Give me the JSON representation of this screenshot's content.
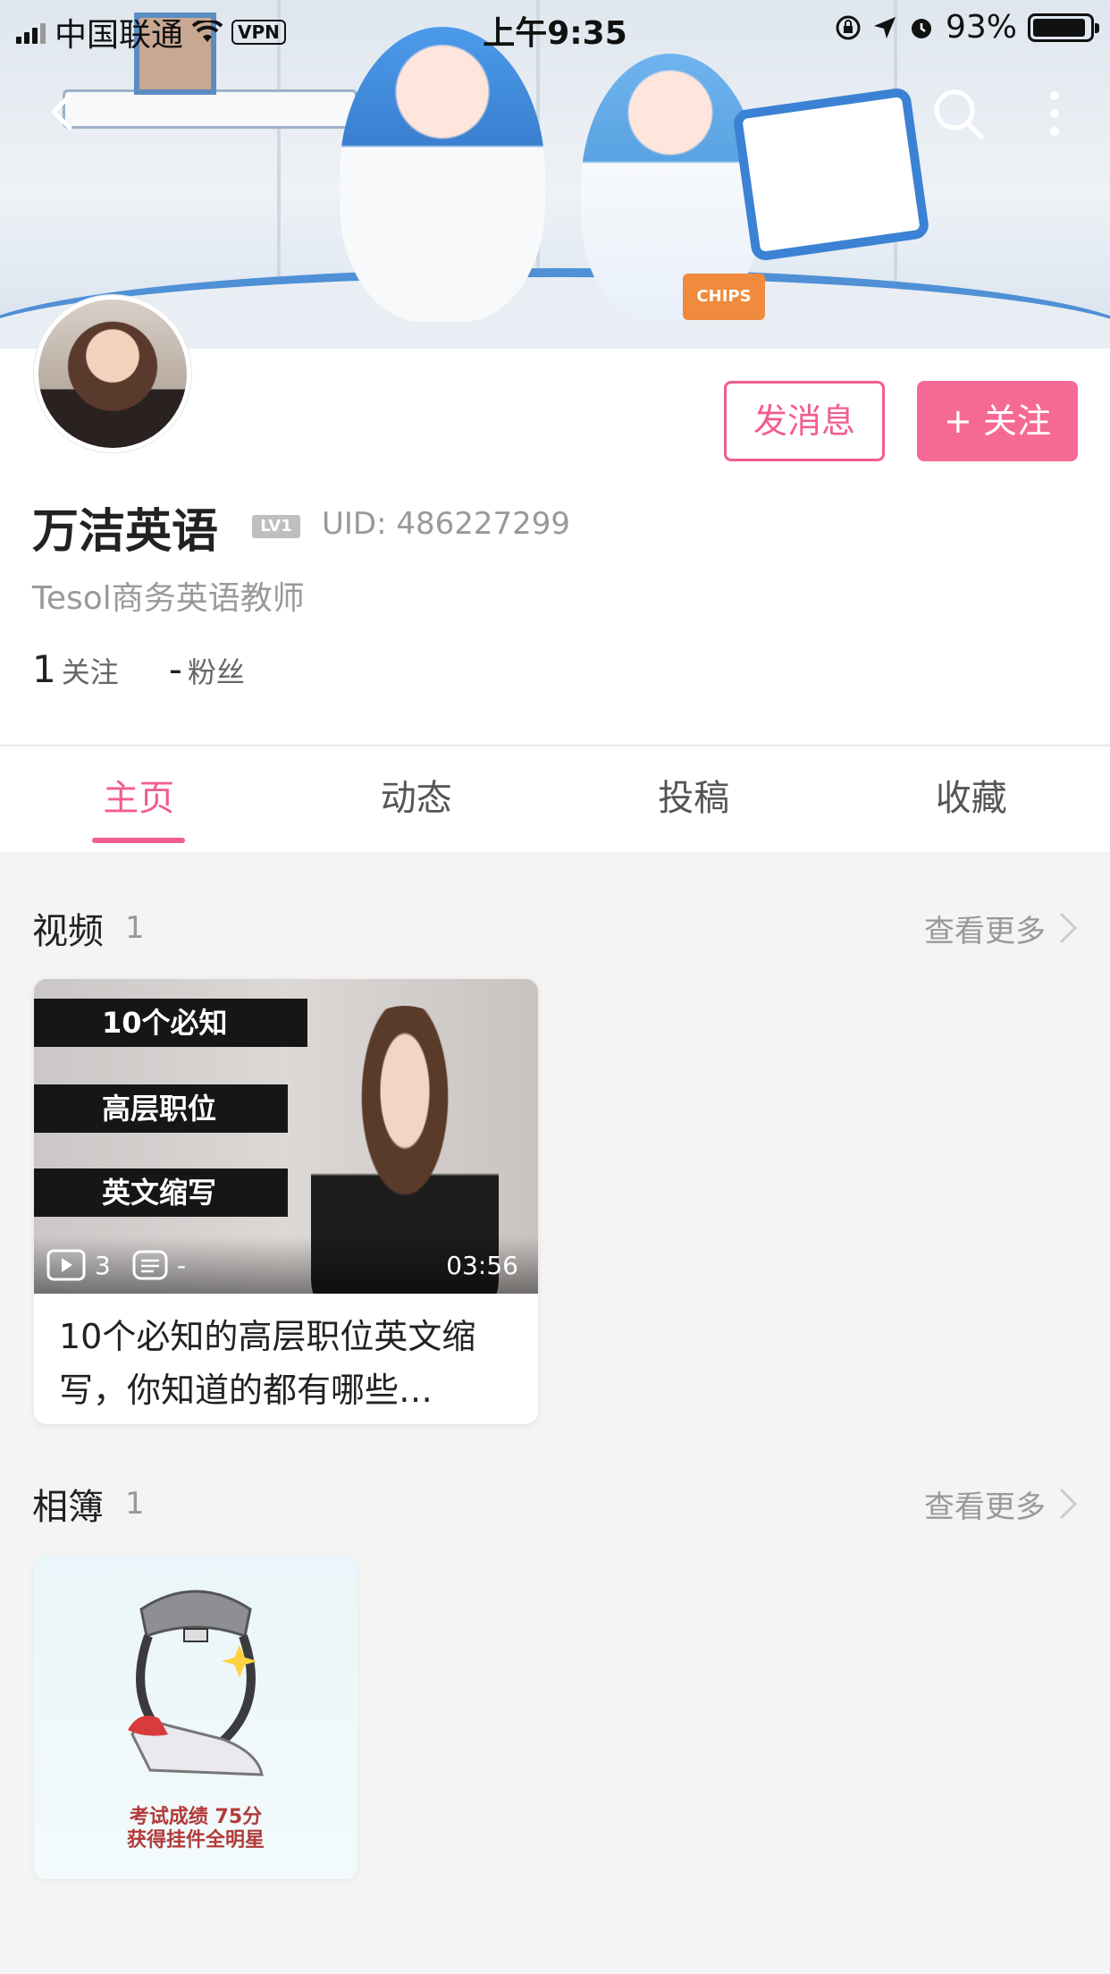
{
  "status_bar": {
    "carrier": "中国联通",
    "vpn": "VPN",
    "time": "上午9:35",
    "battery": "93%",
    "battery_level": 0.93
  },
  "nav": {
    "back_icon": "chevron-left-icon",
    "search_icon": "search-icon",
    "more_icon": "more-vertical-icon"
  },
  "banner": {
    "chips_text": "CHIPS"
  },
  "profile": {
    "name": "万洁英语",
    "level": "LV1",
    "uid_label": "UID:",
    "uid": "486227299",
    "bio": "Tesol商务英语教师",
    "following_count": "1",
    "following_label": "关注",
    "fans_count": "-",
    "fans_label": "粉丝",
    "message_button": "发消息",
    "follow_button": "+ 关注"
  },
  "tabs": [
    {
      "label": "主页",
      "active": true
    },
    {
      "label": "动态",
      "active": false
    },
    {
      "label": "投稿",
      "active": false
    },
    {
      "label": "收藏",
      "active": false
    }
  ],
  "videos_section": {
    "title": "视频",
    "count": "1",
    "more": "查看更多",
    "video": {
      "overlay_lines": [
        "10个必知",
        "高层职位",
        "英文缩写"
      ],
      "plays": "3",
      "danmaku": "-",
      "duration": "03:56",
      "title": "10个必知的高层职位英文缩写，你知道的都有哪些…"
    }
  },
  "album_section": {
    "title": "相簿",
    "count": "1",
    "more": "查看更多",
    "album": {
      "caption_line1": "考试成绩 75分",
      "caption_line2": "获得挂件全明星"
    }
  },
  "colors": {
    "accent": "#f25d8e",
    "follow_bg": "#f56a94",
    "page_bg": "#f4f4f4"
  }
}
